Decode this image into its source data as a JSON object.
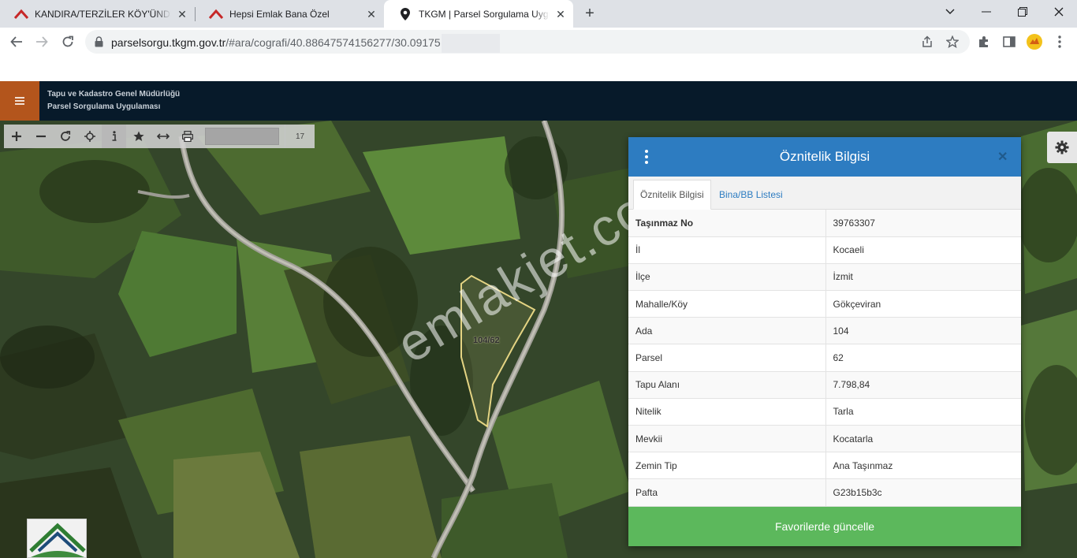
{
  "browser": {
    "tabs": [
      {
        "title": "KANDIRA/TERZİLER KÖY'ÜNDE GENİŞ",
        "close": "✕"
      },
      {
        "title": "Hepsi Emlak Bana Özel",
        "close": "✕"
      },
      {
        "title": "TKGM | Parsel Sorgulama Uygulaması",
        "close": "✕"
      }
    ],
    "new_tab": "+",
    "url_main": "parselsorgu.tkgm.gov.tr",
    "url_path": "/#ara/cografi/40.88647574156277/30.09175",
    "colors": {
      "accent_brand": "#c62828"
    }
  },
  "app": {
    "org_line1": "Tapu ve Kadastro Genel Müdürlüğü",
    "org_line2": "Parsel Sorgulama Uygulaması"
  },
  "map": {
    "zoom_level": "17",
    "parcel_label": "104/62",
    "watermark": "emlakjet.com"
  },
  "panel": {
    "title": "Öznitelik Bilgisi",
    "tabs": [
      "Öznitelik Bilgisi",
      "Bina/BB Listesi"
    ],
    "rows": [
      {
        "key": "Taşınmaz No",
        "value": "39763307"
      },
      {
        "key": "İl",
        "value": "Kocaeli"
      },
      {
        "key": "İlçe",
        "value": "İzmit"
      },
      {
        "key": "Mahalle/Köy",
        "value": "Gökçeviran"
      },
      {
        "key": "Ada",
        "value": "104"
      },
      {
        "key": "Parsel",
        "value": "62"
      },
      {
        "key": "Tapu Alanı",
        "value": "7.798,84"
      },
      {
        "key": "Nitelik",
        "value": "Tarla"
      },
      {
        "key": "Mevkii",
        "value": "Kocatarla"
      },
      {
        "key": "Zemin Tip",
        "value": "Ana Taşınmaz"
      },
      {
        "key": "Pafta",
        "value": "G23b15b3c"
      }
    ],
    "action_button": "Favorilerde güncelle",
    "colors": {
      "header": "#2d7cc1",
      "action": "#5cb85c"
    }
  }
}
